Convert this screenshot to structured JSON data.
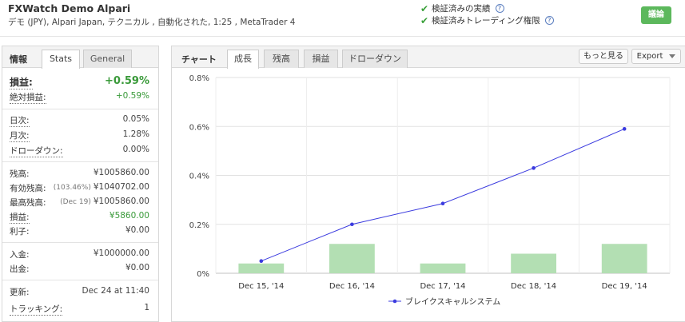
{
  "header": {
    "title": "FXWatch Demo Alpari",
    "subtitle": "デモ (JPY), Alpari Japan, テクニカル , 自動化された, 1:25 , MetaTrader 4",
    "verified_track": "検証済みの実績",
    "verified_privileges": "検証済みトレーディング権限",
    "help_glyph": "?",
    "check_glyph": "✔",
    "discuss_button": "議論"
  },
  "left": {
    "section_label": "情報",
    "tabs": [
      "Stats",
      "General"
    ],
    "gain": {
      "label": "損益:",
      "value": "+0.59%"
    },
    "abs_gain": {
      "label": "絶対損益:",
      "value": "+0.59%"
    },
    "daily": {
      "label": "日次:",
      "value": "0.05%"
    },
    "monthly": {
      "label": "月次:",
      "value": "1.28%"
    },
    "drawdown": {
      "label": "ドローダウン:",
      "value": "0.00%"
    },
    "balance": {
      "label": "残高:",
      "value": "¥1005860.00"
    },
    "equity": {
      "label": "有効残高:",
      "note": "(103.46%)",
      "value": "¥1040702.00"
    },
    "highest": {
      "label": "最高残高:",
      "note": "(Dec 19)",
      "value": "¥1005860.00"
    },
    "profit": {
      "label": "損益:",
      "value": "¥5860.00"
    },
    "interest": {
      "label": "利子:",
      "value": "¥0.00"
    },
    "deposits": {
      "label": "入金:",
      "value": "¥1000000.00"
    },
    "withdrawals": {
      "label": "出金:",
      "value": "¥0.00"
    },
    "updated": {
      "label": "更新:",
      "value": "Dec 24 at 11:40"
    },
    "tracking": {
      "label": "トラッキング:",
      "value": "1"
    }
  },
  "chart_panel": {
    "label": "チャート",
    "tabs": [
      "成長",
      "残高",
      "損益",
      "ドローダウン"
    ],
    "more_button": "もっと見る",
    "export_button": "Export"
  },
  "colors": {
    "line": "#3b3bdf",
    "bar": "#b3dfb3",
    "positive": "#3a9a3a",
    "discuss": "#5cb85c"
  },
  "chart_data": {
    "type": "line",
    "categories": [
      "Dec 15, '14",
      "Dec 16, '14",
      "Dec 17, '14",
      "Dec 18, '14",
      "Dec 19, '14"
    ],
    "series": [
      {
        "name": "ブレイクスキャルシステム",
        "values": [
          0.05,
          0.2,
          0.285,
          0.43,
          0.59
        ]
      }
    ],
    "bars": [
      0.04,
      0.12,
      0.04,
      0.08,
      0.12
    ],
    "ylim": [
      0,
      0.8
    ],
    "yticks": [
      "0%",
      "0.2%",
      "0.4%",
      "0.6%",
      "0.8%"
    ],
    "grid": true,
    "legend": "bottom"
  }
}
